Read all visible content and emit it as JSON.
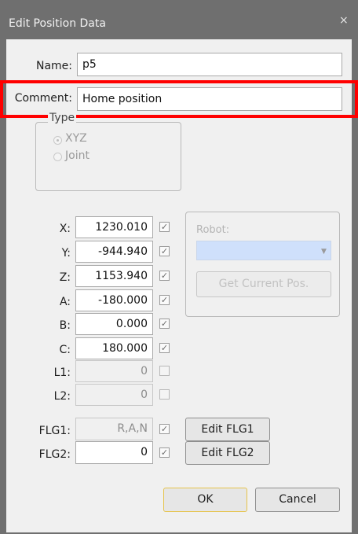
{
  "window": {
    "title": "Edit Position Data",
    "close_glyph": "×"
  },
  "name": {
    "label": "Name:",
    "value": "p5"
  },
  "comment": {
    "label": "Comment:",
    "value": "Home position"
  },
  "type": {
    "legend": "Type",
    "options": [
      {
        "label": "XYZ",
        "selected": true
      },
      {
        "label": "Joint",
        "selected": false
      }
    ]
  },
  "coords": [
    {
      "label": "X:",
      "value": "1230.010",
      "checked": true,
      "enabled": true
    },
    {
      "label": "Y:",
      "value": "-944.940",
      "checked": true,
      "enabled": true
    },
    {
      "label": "Z:",
      "value": "1153.940",
      "checked": true,
      "enabled": true
    },
    {
      "label": "A:",
      "value": "-180.000",
      "checked": true,
      "enabled": true
    },
    {
      "label": "B:",
      "value": "0.000",
      "checked": true,
      "enabled": true
    },
    {
      "label": "C:",
      "value": "180.000",
      "checked": true,
      "enabled": true
    },
    {
      "label": "L1:",
      "value": "0",
      "checked": false,
      "enabled": false
    },
    {
      "label": "L2:",
      "value": "0",
      "checked": false,
      "enabled": false
    }
  ],
  "robot": {
    "label": "Robot:",
    "get_current_pos": "Get Current Pos."
  },
  "flags": [
    {
      "label": "FLG1:",
      "value": "R,A,N",
      "checked": true,
      "enabled": false,
      "edit_button": "Edit FLG1"
    },
    {
      "label": "FLG2:",
      "value": "0",
      "checked": true,
      "enabled": true,
      "edit_button": "Edit FLG2"
    }
  ],
  "buttons": {
    "ok": "OK",
    "cancel": "Cancel"
  },
  "colors": {
    "highlight": "#ff0000",
    "titlebar": "#6f6f6f",
    "robot_select": "#cfe0fb"
  },
  "icons": {
    "check": "checkmark-icon",
    "dropdown": "chevron-down-icon",
    "close": "close-icon"
  }
}
